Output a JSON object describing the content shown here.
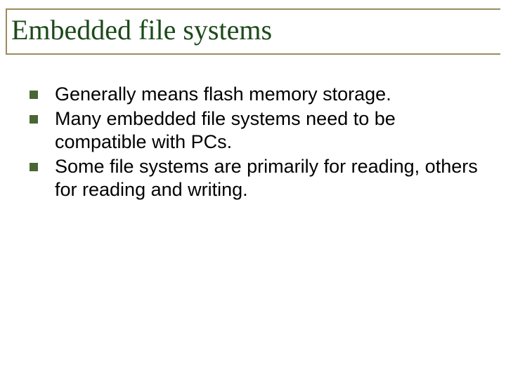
{
  "slide": {
    "title": "Embedded file systems",
    "bullets": [
      {
        "text": "Generally means flash memory storage."
      },
      {
        "text": "Many embedded file systems need to be compatible with PCs."
      },
      {
        "text": "Some file systems are primarily for reading, others for reading and writing."
      }
    ]
  }
}
